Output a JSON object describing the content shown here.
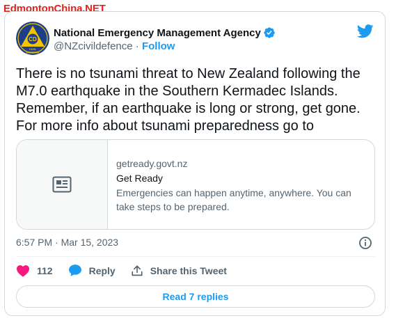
{
  "watermark": "EdmontonChina.NET",
  "colors": {
    "accent": "#1d9bf0",
    "like": "#f91880",
    "watermark": "#e0231c",
    "avatar_bg": "#1d3f8a",
    "avatar_triangle": "#f5c400"
  },
  "author": {
    "name": "National Emergency Management Agency",
    "handle": "@NZcivildefence",
    "separator": "·",
    "follow_label": "Follow",
    "verified_icon": "verified-badge-icon",
    "avatar_text": {
      "monogram": "CD",
      "line1": "CIVIL",
      "line2": "DEFENCE"
    }
  },
  "tweet": {
    "text": "There is no tsunami threat to New Zealand following the M7.0 earthquake in the Southern Kermadec Islands. Remember, if an earthquake is long or strong, get gone. For more info about tsunami preparedness go to"
  },
  "link_card": {
    "domain": "getready.govt.nz",
    "title": "Get Ready",
    "description": "Emergencies can happen anytime, anywhere. You can take steps to be prepared.",
    "thumb_icon": "article-icon"
  },
  "meta": {
    "timestamp": "6:57 PM · Mar 15, 2023",
    "info_icon": "info-icon"
  },
  "actions": {
    "like_count": "112",
    "reply_label": "Reply",
    "share_label": "Share this Tweet"
  },
  "read_replies_label": "Read 7 replies",
  "brand_icon": "twitter-bird-icon"
}
